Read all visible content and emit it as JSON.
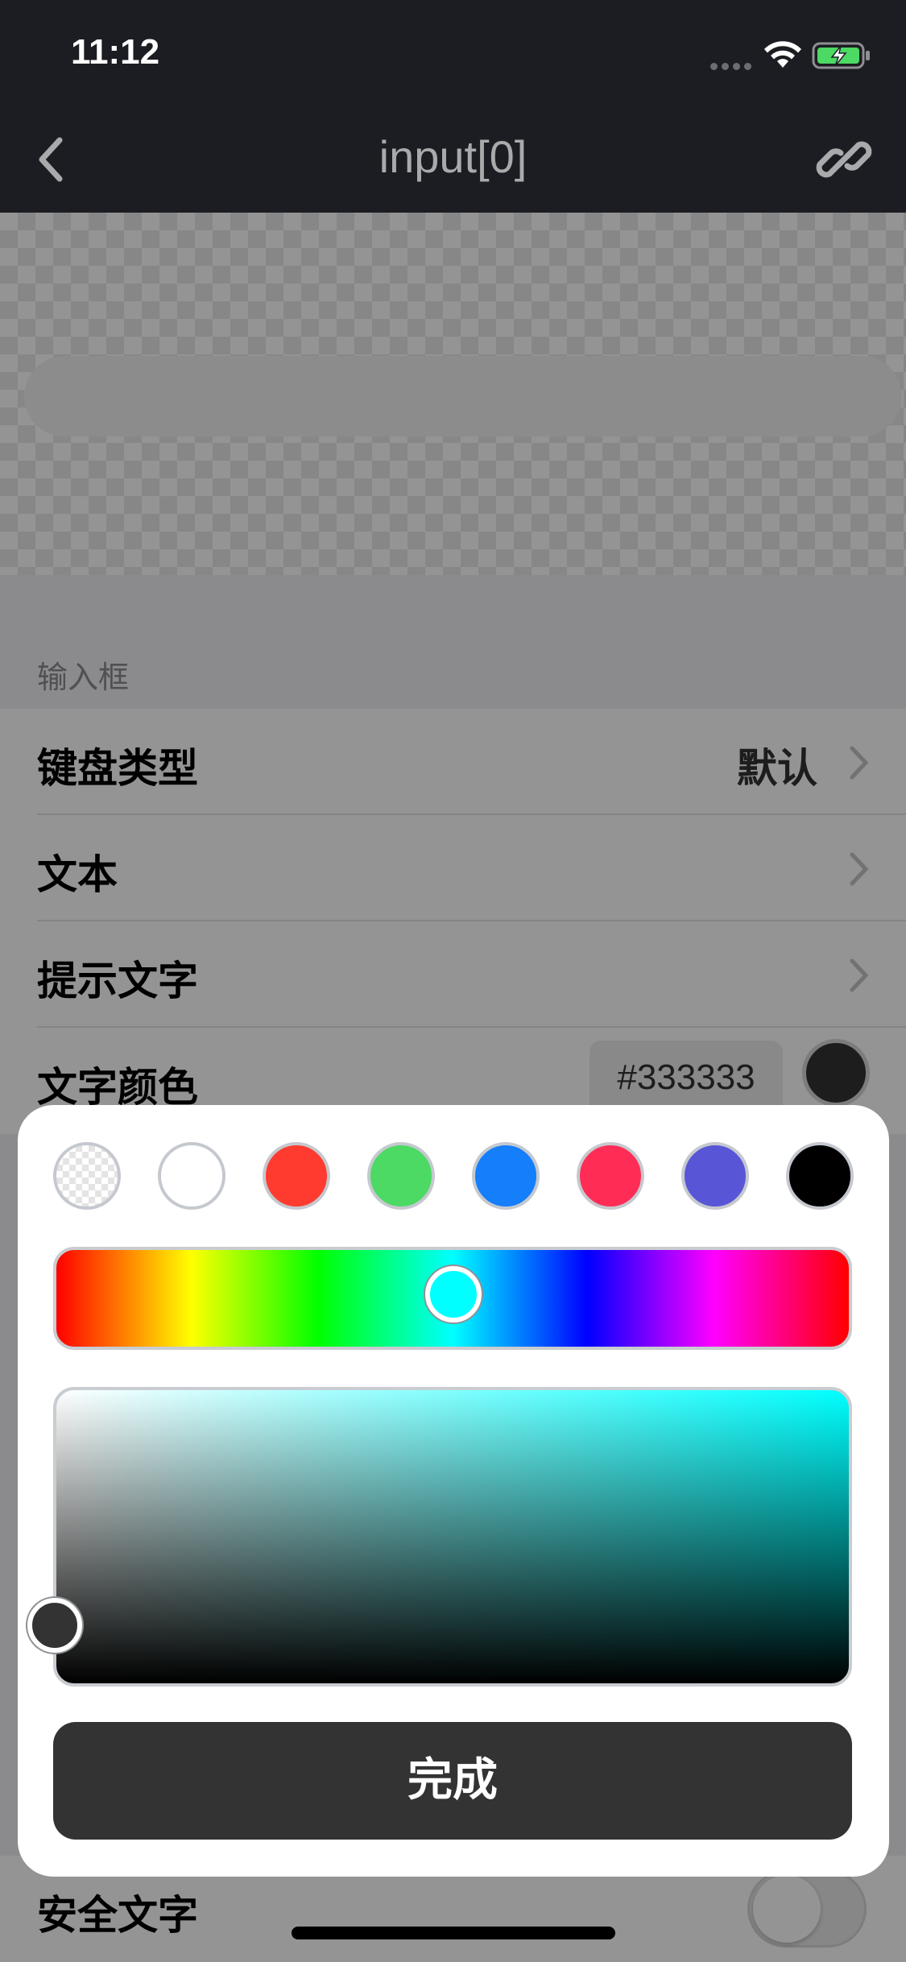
{
  "status_bar": {
    "time": "11:12"
  },
  "nav": {
    "title": "input[0]"
  },
  "section": {
    "header": "输入框"
  },
  "rows": [
    {
      "label": "键盘类型",
      "value": "默认"
    },
    {
      "label": "文本"
    },
    {
      "label": "提示文字"
    },
    {
      "label": "文字颜色",
      "hex": "#333333"
    },
    {
      "label": "安全文字",
      "toggle_on": false
    }
  ],
  "picker": {
    "swatches": [
      {
        "name": "transparent",
        "color": "transparent"
      },
      {
        "name": "white",
        "color": "#ffffff"
      },
      {
        "name": "red",
        "color": "#ff3b30"
      },
      {
        "name": "green",
        "color": "#4cd964"
      },
      {
        "name": "blue",
        "color": "#147efb"
      },
      {
        "name": "pink",
        "color": "#ff2d55"
      },
      {
        "name": "purple",
        "color": "#5856d6"
      },
      {
        "name": "black",
        "color": "#000000"
      }
    ],
    "hue_color": "#00ffff",
    "selected_color": "#333333",
    "done_label": "完成"
  }
}
